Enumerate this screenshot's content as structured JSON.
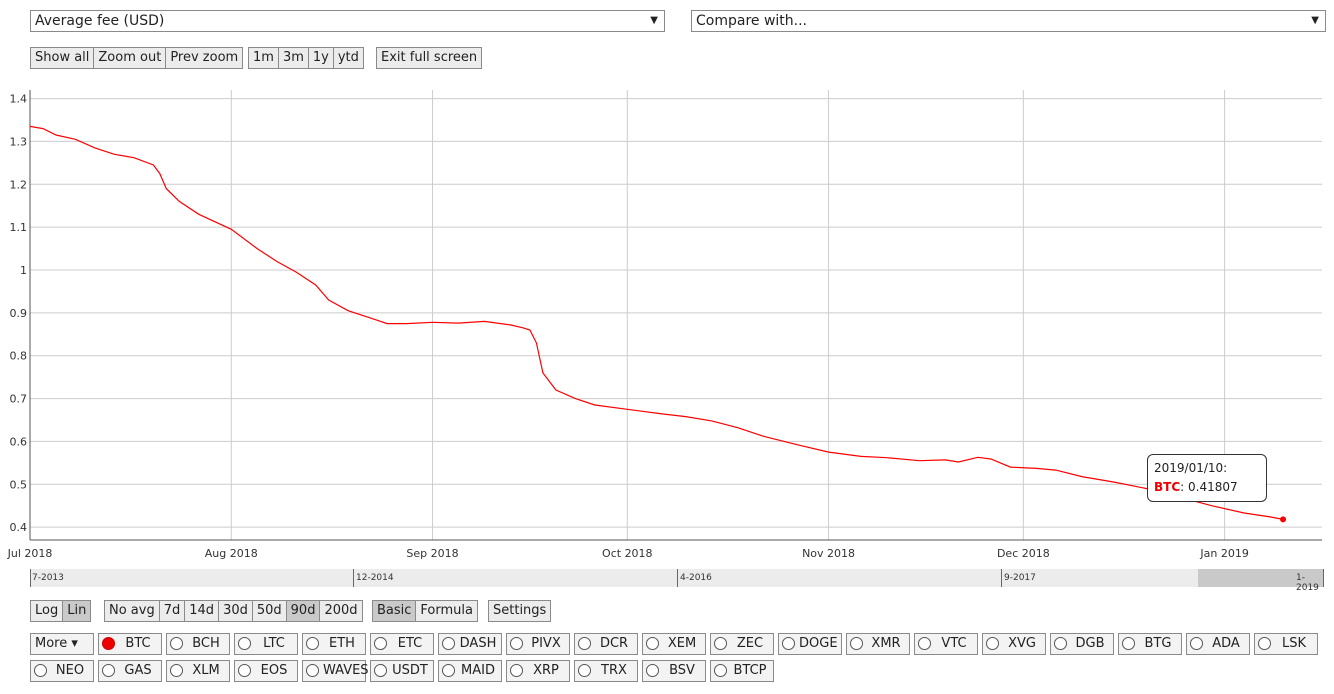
{
  "metric_select": {
    "value": "Average fee (USD)"
  },
  "compare_select": {
    "value": "Compare with..."
  },
  "zoom_buttons": [
    "Show all",
    "Zoom out",
    "Prev zoom"
  ],
  "range_buttons": [
    "1m",
    "3m",
    "1y",
    "ytd"
  ],
  "exit_fullscreen_label": "Exit full screen",
  "scale_buttons": [
    "Log",
    "Lin"
  ],
  "scale_active": "Lin",
  "avg_buttons": [
    "No avg",
    "7d",
    "14d",
    "30d",
    "50d",
    "90d",
    "200d"
  ],
  "avg_active": "90d",
  "mode_buttons": [
    "Basic",
    "Formula"
  ],
  "mode_active": "Basic",
  "settings_label": "Settings",
  "navigator": {
    "labels": [
      "7-2013",
      "12-2014",
      "4-2016",
      "9-2017",
      "1-2019"
    ]
  },
  "tooltip": {
    "date": "2019/01/10:",
    "series": "BTC",
    "value": "0.41807"
  },
  "coins_row1": [
    "More ▾",
    "BTC",
    "BCH",
    "LTC",
    "ETH",
    "ETC",
    "DASH",
    "PIVX",
    "DCR",
    "XEM",
    "ZEC",
    "DOGE",
    "XMR",
    "VTC",
    "XVG",
    "DGB",
    "BTG",
    "ADA",
    "LSK"
  ],
  "coins_row2": [
    "NEO",
    "GAS",
    "XLM",
    "EOS",
    "WAVES",
    "USDT",
    "MAID",
    "XRP",
    "TRX",
    "BSV",
    "BTCP"
  ],
  "selected_coin": "BTC",
  "colors": {
    "line": "#ff0000",
    "grid": "#cccccc",
    "selected": "#e00000"
  },
  "chart_data": {
    "type": "line",
    "x_ticks": [
      "Jul 2018",
      "Aug 2018",
      "Sep 2018",
      "Oct 2018",
      "Nov 2018",
      "Dec 2018",
      "Jan 2019"
    ],
    "y_ticks": [
      "0.4",
      "0.5",
      "0.6",
      "0.7",
      "0.8",
      "0.9",
      "1",
      "1.1",
      "1.2",
      "1.3",
      "1.4"
    ],
    "ylim": [
      0.37,
      1.42
    ],
    "xlim": [
      "2018-07-01",
      "2019-01-16"
    ],
    "grid": true,
    "series": [
      {
        "name": "BTC",
        "points": [
          [
            "2018-07-01",
            1.335
          ],
          [
            "2018-07-03",
            1.33
          ],
          [
            "2018-07-05",
            1.315
          ],
          [
            "2018-07-08",
            1.305
          ],
          [
            "2018-07-11",
            1.285
          ],
          [
            "2018-07-14",
            1.27
          ],
          [
            "2018-07-17",
            1.262
          ],
          [
            "2018-07-20",
            1.245
          ],
          [
            "2018-07-21",
            1.225
          ],
          [
            "2018-07-22",
            1.19
          ],
          [
            "2018-07-24",
            1.16
          ],
          [
            "2018-07-27",
            1.13
          ],
          [
            "2018-08-01",
            1.095
          ],
          [
            "2018-08-05",
            1.05
          ],
          [
            "2018-08-08",
            1.02
          ],
          [
            "2018-08-11",
            0.995
          ],
          [
            "2018-08-14",
            0.965
          ],
          [
            "2018-08-16",
            0.93
          ],
          [
            "2018-08-19",
            0.905
          ],
          [
            "2018-08-22",
            0.89
          ],
          [
            "2018-08-25",
            0.875
          ],
          [
            "2018-08-28",
            0.875
          ],
          [
            "2018-09-01",
            0.878
          ],
          [
            "2018-09-05",
            0.876
          ],
          [
            "2018-09-09",
            0.88
          ],
          [
            "2018-09-13",
            0.872
          ],
          [
            "2018-09-15",
            0.865
          ],
          [
            "2018-09-16",
            0.86
          ],
          [
            "2018-09-17",
            0.83
          ],
          [
            "2018-09-18",
            0.76
          ],
          [
            "2018-09-20",
            0.72
          ],
          [
            "2018-09-23",
            0.7
          ],
          [
            "2018-09-26",
            0.685
          ],
          [
            "2018-10-01",
            0.675
          ],
          [
            "2018-10-06",
            0.665
          ],
          [
            "2018-10-10",
            0.658
          ],
          [
            "2018-10-14",
            0.648
          ],
          [
            "2018-10-18",
            0.632
          ],
          [
            "2018-10-22",
            0.612
          ],
          [
            "2018-10-27",
            0.593
          ],
          [
            "2018-11-01",
            0.575
          ],
          [
            "2018-11-06",
            0.565
          ],
          [
            "2018-11-10",
            0.562
          ],
          [
            "2018-11-15",
            0.555
          ],
          [
            "2018-11-19",
            0.557
          ],
          [
            "2018-11-21",
            0.552
          ],
          [
            "2018-11-24",
            0.563
          ],
          [
            "2018-11-26",
            0.559
          ],
          [
            "2018-11-29",
            0.54
          ],
          [
            "2018-12-03",
            0.537
          ],
          [
            "2018-12-06",
            0.533
          ],
          [
            "2018-12-10",
            0.518
          ],
          [
            "2018-12-15",
            0.505
          ],
          [
            "2018-12-20",
            0.49
          ],
          [
            "2018-12-25",
            0.47
          ],
          [
            "2018-12-30",
            0.45
          ],
          [
            "2019-01-04",
            0.433
          ],
          [
            "2019-01-08",
            0.424
          ],
          [
            "2019-01-10",
            0.418
          ]
        ]
      }
    ]
  }
}
